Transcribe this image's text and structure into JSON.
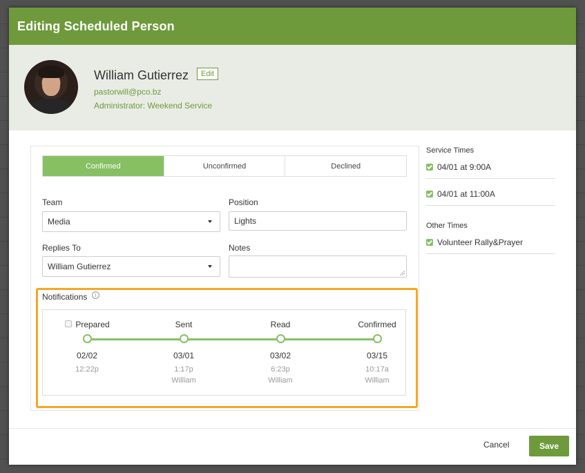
{
  "modal": {
    "title": "Editing Scheduled Person"
  },
  "person": {
    "name": "William Gutierrez",
    "edit_label": "Edit",
    "email": "pastorwill@pco.bz",
    "role": "Administrator: Weekend Service"
  },
  "status_tabs": [
    {
      "label": "Confirmed",
      "active": true
    },
    {
      "label": "Unconfirmed",
      "active": false
    },
    {
      "label": "Declined",
      "active": false
    }
  ],
  "form": {
    "team_label": "Team",
    "team_value": "Media",
    "position_label": "Position",
    "position_value": "Lights",
    "replies_to_label": "Replies To",
    "replies_to_value": "William Gutierrez",
    "notes_label": "Notes",
    "notes_value": ""
  },
  "notifications": {
    "label": "Notifications",
    "info_icon": "i",
    "stages": [
      {
        "title": "Prepared",
        "date": "02/02",
        "time": "12:22p",
        "who": ""
      },
      {
        "title": "Sent",
        "date": "03/01",
        "time": "1:17p",
        "who": "William"
      },
      {
        "title": "Read",
        "date": "03/02",
        "time": "6:23p",
        "who": "William"
      },
      {
        "title": "Confirmed",
        "date": "03/15",
        "time": "10:17a",
        "who": "William"
      }
    ]
  },
  "sidebar": {
    "service_times_title": "Service Times",
    "service_times": [
      "04/01 at 9:00A",
      "04/01 at 11:00A"
    ],
    "other_times_title": "Other Times",
    "other_times": [
      "Volunteer Rally&Prayer"
    ]
  },
  "footer": {
    "cancel_label": "Cancel",
    "save_label": "Save"
  },
  "colors": {
    "brand_green": "#6e9a3c",
    "accent_green": "#86c063",
    "highlight_orange": "#f6a623"
  }
}
